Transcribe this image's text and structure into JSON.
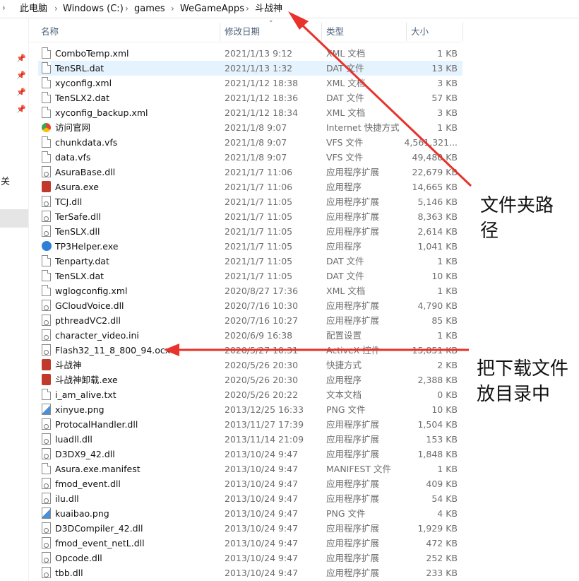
{
  "breadcrumb": [
    "此电脑",
    "Windows (C:)",
    "games",
    "WeGameApps",
    "斗战神"
  ],
  "nav": {
    "partial_label": "目关"
  },
  "columns": {
    "name": "名称",
    "date": "修改日期",
    "type": "类型",
    "size": "大小"
  },
  "files": [
    {
      "name": "ComboTemp.xml",
      "date": "2021/1/13 9:12",
      "type": "XML 文档",
      "size": "1 KB",
      "icon": "document-icon"
    },
    {
      "name": "TenSRL.dat",
      "date": "2021/1/13 1:32",
      "type": "DAT 文件",
      "size": "13 KB",
      "icon": "document-icon",
      "selected": true
    },
    {
      "name": "xyconfig.xml",
      "date": "2021/1/12 18:38",
      "type": "XML 文档",
      "size": "3 KB",
      "icon": "document-icon"
    },
    {
      "name": "TenSLX2.dat",
      "date": "2021/1/12 18:36",
      "type": "DAT 文件",
      "size": "57 KB",
      "icon": "document-icon"
    },
    {
      "name": "xyconfig_backup.xml",
      "date": "2021/1/12 18:34",
      "type": "XML 文档",
      "size": "3 KB",
      "icon": "document-icon"
    },
    {
      "name": "访问官网",
      "date": "2021/1/8 9:07",
      "type": "Internet 快捷方式",
      "size": "1 KB",
      "icon": "web-shortcut-icon"
    },
    {
      "name": "chunkdata.vfs",
      "date": "2021/1/8 9:07",
      "type": "VFS 文件",
      "size": "4,561,321...",
      "icon": "document-icon"
    },
    {
      "name": "data.vfs",
      "date": "2021/1/8 9:07",
      "type": "VFS 文件",
      "size": "49,480 KB",
      "icon": "document-icon"
    },
    {
      "name": "AsuraBase.dll",
      "date": "2021/1/7 11:06",
      "type": "应用程序扩展",
      "size": "22,679 KB",
      "icon": "dll-icon"
    },
    {
      "name": "Asura.exe",
      "date": "2021/1/7 11:06",
      "type": "应用程序",
      "size": "14,665 KB",
      "icon": "game-exe-icon"
    },
    {
      "name": "TCJ.dll",
      "date": "2021/1/7 11:05",
      "type": "应用程序扩展",
      "size": "5,146 KB",
      "icon": "dll-icon"
    },
    {
      "name": "TerSafe.dll",
      "date": "2021/1/7 11:05",
      "type": "应用程序扩展",
      "size": "8,363 KB",
      "icon": "dll-icon"
    },
    {
      "name": "TenSLX.dll",
      "date": "2021/1/7 11:05",
      "type": "应用程序扩展",
      "size": "2,614 KB",
      "icon": "dll-icon"
    },
    {
      "name": "TP3Helper.exe",
      "date": "2021/1/7 11:05",
      "type": "应用程序",
      "size": "1,041 KB",
      "icon": "tp3-exe-icon"
    },
    {
      "name": "Tenparty.dat",
      "date": "2021/1/7 11:05",
      "type": "DAT 文件",
      "size": "1 KB",
      "icon": "document-icon"
    },
    {
      "name": "TenSLX.dat",
      "date": "2021/1/7 11:05",
      "type": "DAT 文件",
      "size": "10 KB",
      "icon": "document-icon"
    },
    {
      "name": "wglogconfig.xml",
      "date": "2020/8/27 17:36",
      "type": "XML 文档",
      "size": "1 KB",
      "icon": "document-icon"
    },
    {
      "name": "GCloudVoice.dll",
      "date": "2020/7/16 10:30",
      "type": "应用程序扩展",
      "size": "4,790 KB",
      "icon": "dll-icon"
    },
    {
      "name": "pthreadVC2.dll",
      "date": "2020/7/16 10:27",
      "type": "应用程序扩展",
      "size": "85 KB",
      "icon": "dll-icon"
    },
    {
      "name": "character_video.ini",
      "date": "2020/6/9 16:38",
      "type": "配置设置",
      "size": "1 KB",
      "icon": "config-icon"
    },
    {
      "name": "Flash32_11_8_800_94.ocx",
      "date": "2020/5/27 10:31",
      "type": "ActiveX 控件",
      "size": "15,851 KB",
      "icon": "dll-icon"
    },
    {
      "name": "斗战神",
      "date": "2020/5/26 20:30",
      "type": "快捷方式",
      "size": "2 KB",
      "icon": "game-shortcut-icon"
    },
    {
      "name": "斗战神卸载.exe",
      "date": "2020/5/26 20:30",
      "type": "应用程序",
      "size": "2,388 KB",
      "icon": "game-exe-icon"
    },
    {
      "name": "i_am_alive.txt",
      "date": "2020/5/26 20:22",
      "type": "文本文档",
      "size": "0 KB",
      "icon": "document-icon"
    },
    {
      "name": "xinyue.png",
      "date": "2013/12/25 16:33",
      "type": "PNG 文件",
      "size": "10 KB",
      "icon": "image-icon"
    },
    {
      "name": "ProtocalHandler.dll",
      "date": "2013/11/27 17:39",
      "type": "应用程序扩展",
      "size": "1,504 KB",
      "icon": "dll-icon"
    },
    {
      "name": "luadll.dll",
      "date": "2013/11/14 21:09",
      "type": "应用程序扩展",
      "size": "153 KB",
      "icon": "dll-icon"
    },
    {
      "name": "D3DX9_42.dll",
      "date": "2013/10/24 9:47",
      "type": "应用程序扩展",
      "size": "1,848 KB",
      "icon": "dll-icon"
    },
    {
      "name": "Asura.exe.manifest",
      "date": "2013/10/24 9:47",
      "type": "MANIFEST 文件",
      "size": "1 KB",
      "icon": "document-icon"
    },
    {
      "name": "fmod_event.dll",
      "date": "2013/10/24 9:47",
      "type": "应用程序扩展",
      "size": "409 KB",
      "icon": "dll-icon"
    },
    {
      "name": "ilu.dll",
      "date": "2013/10/24 9:47",
      "type": "应用程序扩展",
      "size": "54 KB",
      "icon": "dll-icon"
    },
    {
      "name": "kuaibao.png",
      "date": "2013/10/24 9:47",
      "type": "PNG 文件",
      "size": "4 KB",
      "icon": "image-icon"
    },
    {
      "name": "D3DCompiler_42.dll",
      "date": "2013/10/24 9:47",
      "type": "应用程序扩展",
      "size": "1,929 KB",
      "icon": "dll-icon"
    },
    {
      "name": "fmod_event_netL.dll",
      "date": "2013/10/24 9:47",
      "type": "应用程序扩展",
      "size": "472 KB",
      "icon": "dll-icon"
    },
    {
      "name": "Opcode.dll",
      "date": "2013/10/24 9:47",
      "type": "应用程序扩展",
      "size": "252 KB",
      "icon": "dll-icon"
    },
    {
      "name": "tbb.dll",
      "date": "2013/10/24 9:47",
      "type": "应用程序扩展",
      "size": "233 KB",
      "icon": "dll-icon"
    }
  ],
  "annotations": {
    "path_note": "文件夹路径",
    "path_note_line1": "文件夹路",
    "path_note_line2": "径",
    "download_note": "把下载文件放目录中",
    "download_note_line1": "把下载文件",
    "download_note_line2": "放目录中",
    "arrow_color": "#e8322b"
  }
}
